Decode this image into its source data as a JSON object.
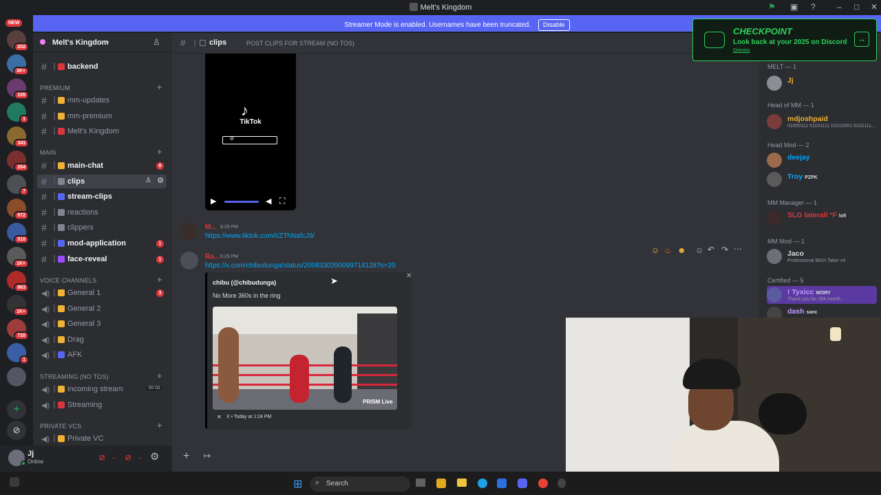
{
  "window": {
    "title": "Melt's Kingdom"
  },
  "banner": {
    "text": "Streamer Mode is enabled. Usernames have been truncated.",
    "button": "Disable"
  },
  "rail": {
    "new_label": "NEW",
    "servers": [
      {
        "badge": "202"
      },
      {
        "badge": "3K+"
      },
      {
        "badge": "105"
      },
      {
        "badge": "1"
      },
      {
        "badge": "343"
      },
      {
        "badge": "264"
      },
      {
        "badge": "7"
      },
      {
        "badge": "972"
      },
      {
        "badge": "510"
      },
      {
        "badge": "1K+"
      },
      {
        "badge": "963"
      },
      {
        "badge": "1K+"
      },
      {
        "badge": "720"
      },
      {
        "badge": "1"
      },
      {
        "badge": ""
      }
    ]
  },
  "server": {
    "name": "Melt's Kingdom"
  },
  "sidebar": {
    "top_channel": "backend",
    "categories": [
      {
        "name": "PREMIUM"
      },
      {
        "name": "MAIN"
      },
      {
        "name": "VOICE CHANNELS"
      },
      {
        "name": "STREAMING (NO TOS)"
      },
      {
        "name": "PRIVATE VCS"
      }
    ],
    "premium": [
      {
        "label": "mm-updates"
      },
      {
        "label": "mm-premium"
      },
      {
        "label": "Melt's Kingdom"
      }
    ],
    "main": [
      {
        "label": "main-chat",
        "count": "8"
      },
      {
        "label": "clips"
      },
      {
        "label": "stream-clips"
      },
      {
        "label": "reactions"
      },
      {
        "label": "clippers"
      },
      {
        "label": "mod-application",
        "count": "1"
      },
      {
        "label": "face-reveal",
        "count": "1"
      }
    ],
    "voice": [
      {
        "label": "General 1",
        "count": "3"
      },
      {
        "label": "General 2"
      },
      {
        "label": "General 3"
      },
      {
        "label": "Drag"
      },
      {
        "label": "AFK"
      }
    ],
    "streaming": [
      {
        "label": "incoming stream",
        "extra": "00 02"
      },
      {
        "label": "Streaming"
      }
    ],
    "private": [
      {
        "label": "Private VC"
      }
    ]
  },
  "user": {
    "name": "Jj",
    "status": "Online"
  },
  "chat_header": {
    "channel": "clips",
    "topic": "POST CLIPS FOR STREAM (NO TOS)"
  },
  "messages": {
    "tiktok_embed": {
      "brand": "TikTok",
      "handle": "@"
    },
    "msg1": {
      "name": "M...",
      "time": "6:29 PM",
      "link": "https://www.tiktok.com/t/ZThNafcJ9/"
    },
    "msg2": {
      "name": "Ra...",
      "time": "6:29 PM",
      "link": "https://x.com/chibudunga/status/2009330350099714128?s=20"
    },
    "embed": {
      "author": "chibu (@chibudunga)",
      "text": "No More 360s in the ring",
      "footer": "X • Today at 1:24 PM",
      "watermark": "PRISM Live"
    }
  },
  "checkpoint": {
    "title": "CHECKPOINT",
    "subtitle": "Look back at your 2025 on Discord",
    "dismiss": "Dismiss"
  },
  "members": {
    "groups": [
      {
        "name": "MELT — 1"
      },
      {
        "name": "Head of MM — 1"
      },
      {
        "name": "Head Mod — 2"
      },
      {
        "name": "MM Manager — 1"
      },
      {
        "name": "MM Mod — 1"
      },
      {
        "name": "Certified — 5"
      }
    ],
    "list": [
      {
        "name": "Jj",
        "status": "",
        "color": "#f0b232"
      },
      {
        "name": "mdjoshpaid",
        "status": "01000111 01101111 01010001 0110111...",
        "color": "#f0b232"
      },
      {
        "name": "deejay",
        "status": "",
        "color": "#00a8fc"
      },
      {
        "name": "Troy",
        "status": "",
        "tag": "PZPK",
        "color": "#00a8fc"
      },
      {
        "name": "SLG laterall °F",
        "status": "",
        "tag": "lofi",
        "color": "#da373c"
      },
      {
        "name": "Jaco",
        "status": "Professional Bitch Taker x4",
        "color": "#dbdee1"
      },
      {
        "name": "! Tyxicc",
        "status": "Thank you for 30k month...",
        "tag": "WORY",
        "color": "#c89bff"
      },
      {
        "name": "dash",
        "status": "",
        "tag": "sanc",
        "color": "#c89bff"
      }
    ]
  },
  "taskbar": {
    "search": "Search"
  }
}
